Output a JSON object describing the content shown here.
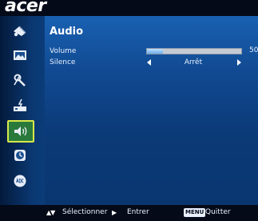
{
  "brand": {
    "logo_text": "acer"
  },
  "nav": {
    "items": [
      {
        "name": "color-icon",
        "active": false
      },
      {
        "name": "image-icon",
        "active": false
      },
      {
        "name": "settings-icon",
        "active": false
      },
      {
        "name": "management-icon",
        "active": false
      },
      {
        "name": "audio-icon",
        "active": true
      },
      {
        "name": "timer-icon",
        "active": false
      },
      {
        "name": "language-icon",
        "active": false
      }
    ]
  },
  "panel": {
    "title": "Audio",
    "volume": {
      "label": "Volume",
      "value": "50",
      "level_percent": 17
    },
    "silence": {
      "label": "Silence",
      "value": "Arrêt"
    }
  },
  "footer": {
    "select_label": "Sélectionner",
    "enter_label": "Entrer",
    "menu_key": "MENU",
    "quit_label": "Quitter"
  },
  "colors": {
    "background": "#0a3a78",
    "panel_top": "#1961b2",
    "bar": "#050a18",
    "active_border": "#d8e84a",
    "active_fill": "#2a7a3c"
  }
}
